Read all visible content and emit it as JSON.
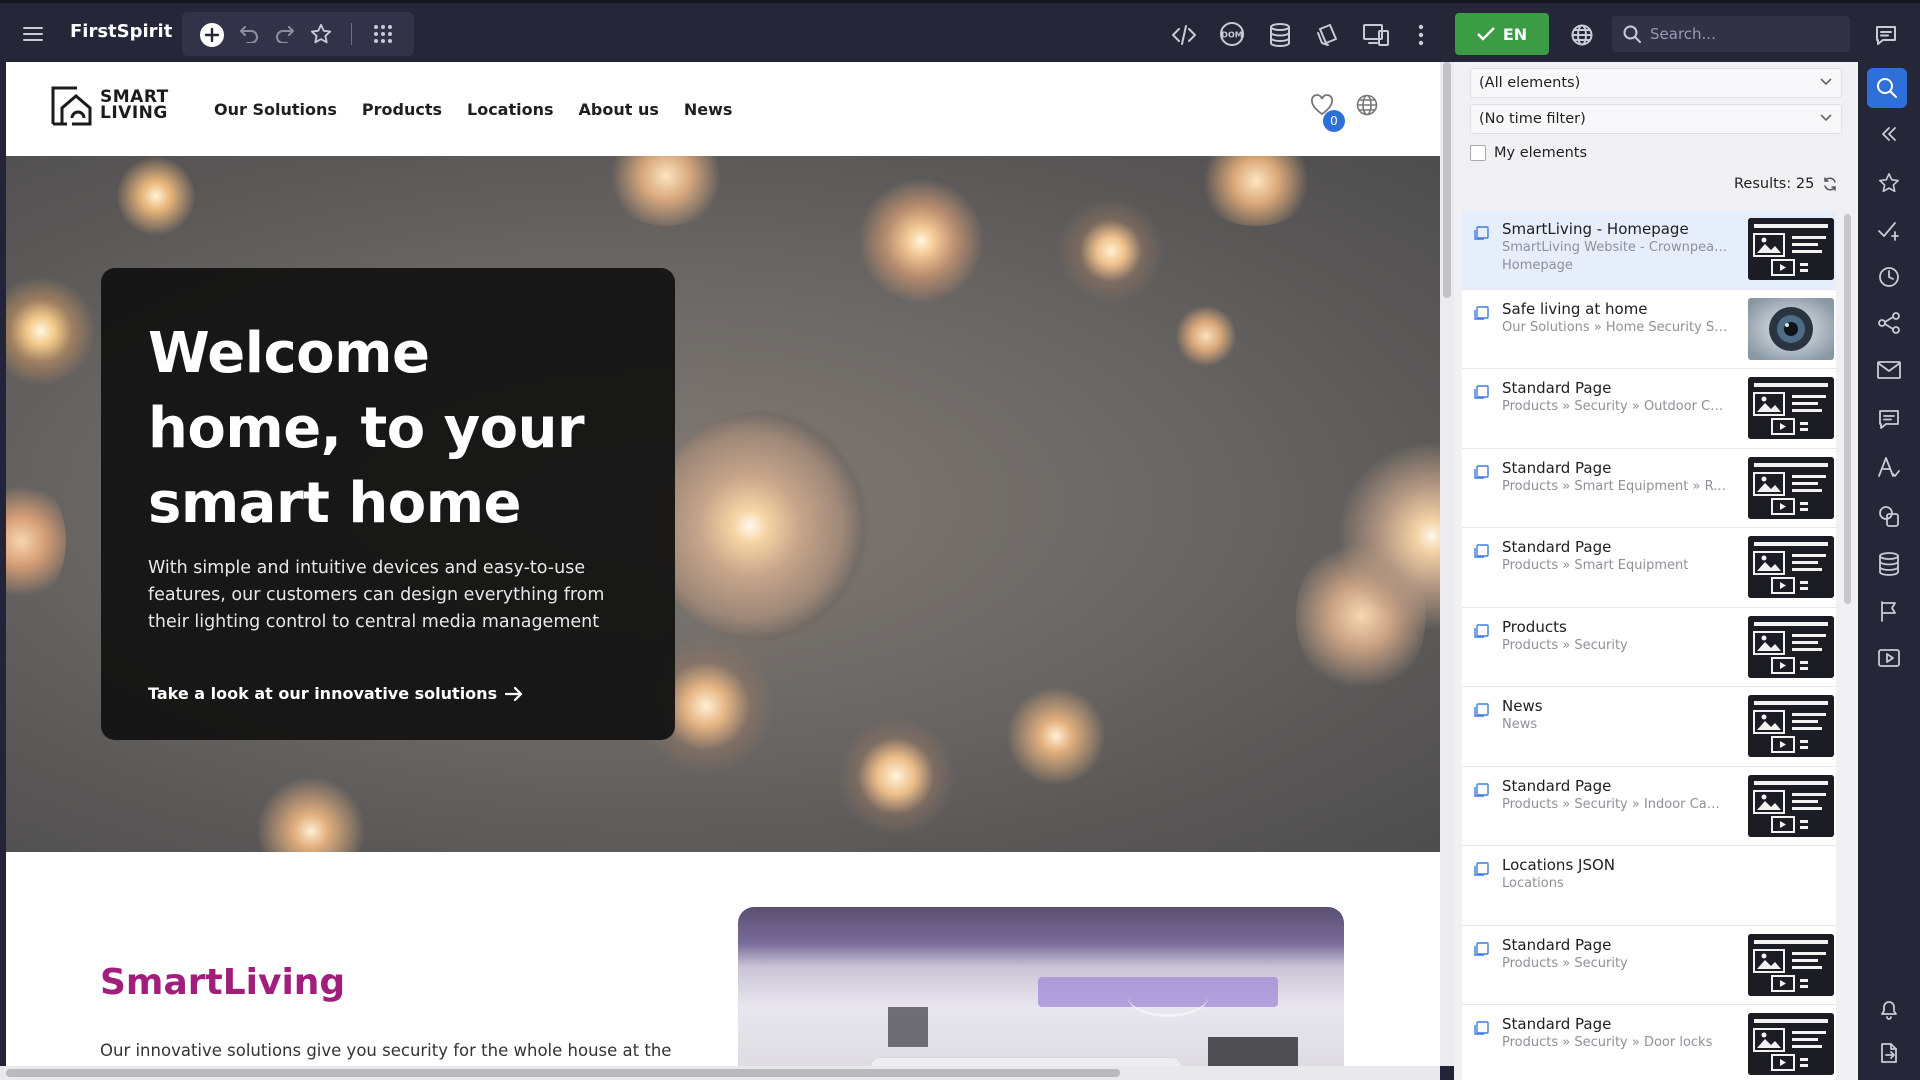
{
  "app": {
    "title": "FirstSpirit"
  },
  "toolbar": {
    "language_label": "EN",
    "search_placeholder": "Search...",
    "icons": [
      "menu-icon",
      "add-icon",
      "undo-icon",
      "redo-icon",
      "star-icon",
      "apps-grid-icon",
      "code-icon",
      "dom-icon",
      "database-icon",
      "pages-icon",
      "devices-icon",
      "more-vertical-icon",
      "globe-icon",
      "search-icon",
      "chat-icon"
    ],
    "dom_label": "DOM"
  },
  "site": {
    "logo_line1": "SMART",
    "logo_line2": "LIVING",
    "nav": [
      "Our Solutions",
      "Products",
      "Locations",
      "About us",
      "News"
    ],
    "wishlist_count": "0",
    "hero": {
      "title": "Welcome home, to your smart home",
      "text": "With simple and intuitive devices and easy-to-use features, our customers can design everything from their lighting control to central media management",
      "cta": "Take a look at our innovative solutions"
    },
    "section": {
      "brand": "SmartLiving",
      "text": "Our innovative solutions give you security for the whole house at the most"
    }
  },
  "panel": {
    "element_filter": "(All elements)",
    "time_filter": "(No time filter)",
    "my_elements_label": "My elements",
    "results_label": "Results: 25",
    "results": [
      {
        "title": "SmartLiving - Homepage",
        "path": "SmartLiving Website - Crownpeak r...",
        "sub": "Homepage",
        "thumb": "page"
      },
      {
        "title": "Safe living at home",
        "path": "Our Solutions » Home Security Spe...",
        "sub": "",
        "thumb": "camera"
      },
      {
        "title": "Standard Page",
        "path": "Products » Security » Outdoor Cam...",
        "sub": "",
        "thumb": "page"
      },
      {
        "title": "Standard Page",
        "path": "Products » Smart Equipment » Rob...",
        "sub": "",
        "thumb": "page"
      },
      {
        "title": "Standard Page",
        "path": "Products » Smart Equipment",
        "sub": "",
        "thumb": "page"
      },
      {
        "title": "Products",
        "path": "Products » Security",
        "sub": "",
        "thumb": "page"
      },
      {
        "title": "News",
        "path": "News",
        "sub": "",
        "thumb": "page"
      },
      {
        "title": "Standard Page",
        "path": "Products » Security » Indoor Came...",
        "sub": "",
        "thumb": "page"
      },
      {
        "title": "Locations JSON",
        "path": "Locations",
        "sub": "",
        "thumb": "none"
      },
      {
        "title": "Standard Page",
        "path": "Products » Security",
        "sub": "",
        "thumb": "page"
      },
      {
        "title": "Standard Page",
        "path": "Products » Security » Door locks",
        "sub": "",
        "thumb": "page"
      }
    ]
  },
  "rail": {
    "icons": [
      "search-icon",
      "collapse-icon",
      "star-icon",
      "tasks-icon",
      "history-icon",
      "share-icon",
      "mail-icon",
      "comments-icon",
      "typography-icon",
      "media-icon",
      "database-icon",
      "flag-icon",
      "video-icon",
      "bell-icon",
      "export-icon"
    ]
  },
  "colors": {
    "toolbar_bg": "#252638",
    "accent_green": "#3c9b45",
    "accent_blue": "#2f6fd9",
    "brand_magenta": "#a11e7c"
  }
}
